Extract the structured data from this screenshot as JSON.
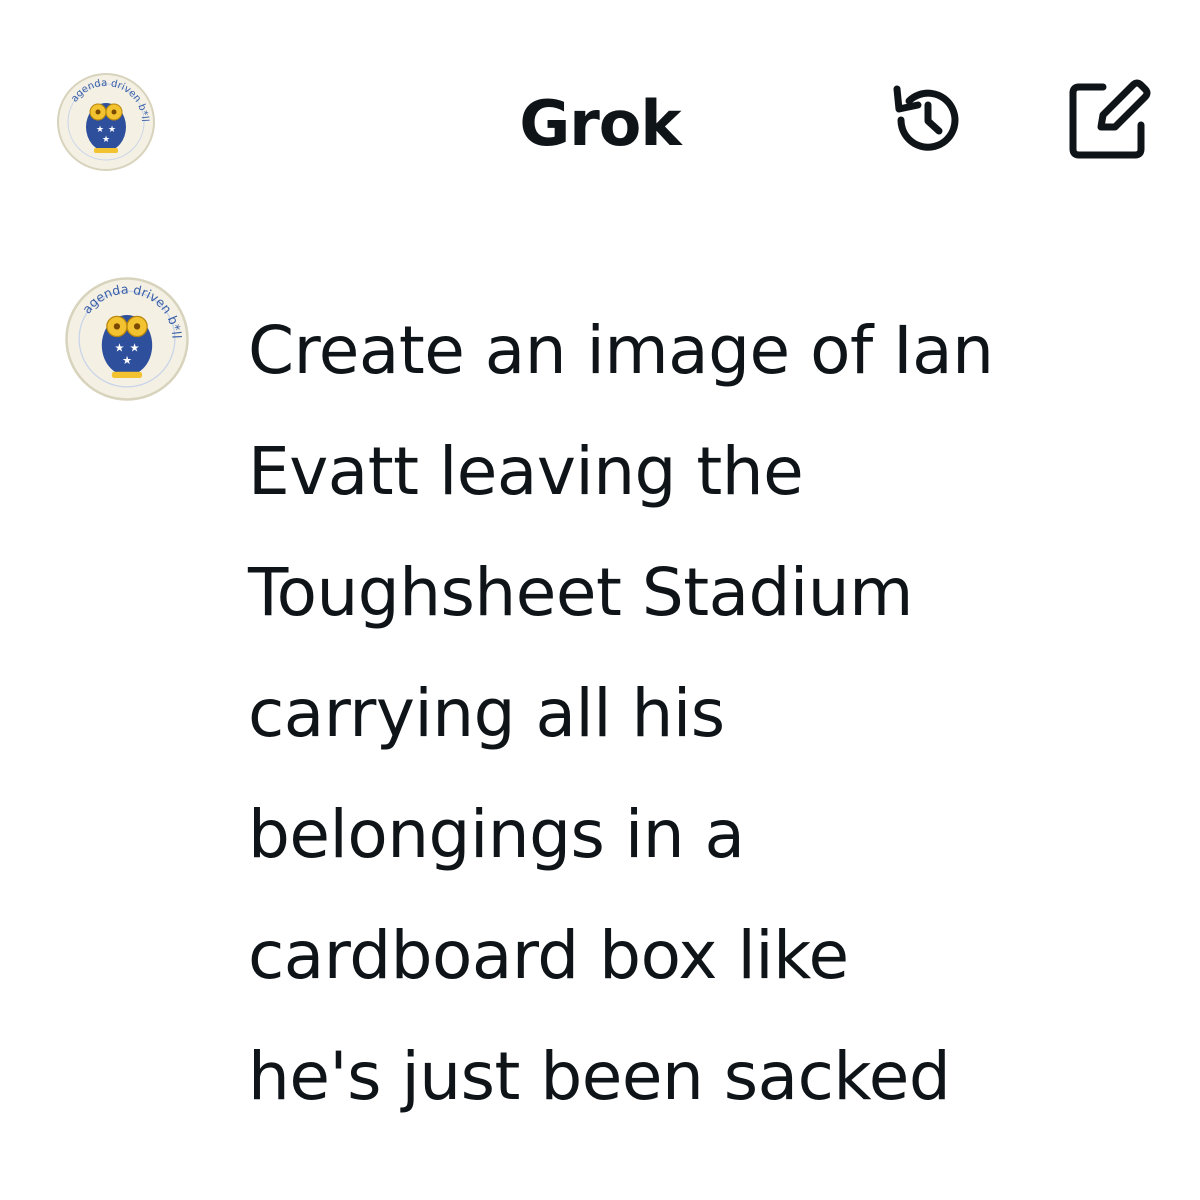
{
  "header": {
    "title": "Grok",
    "avatar_icon": "owl-logo-icon",
    "history_icon": "history-icon",
    "compose_icon": "compose-icon"
  },
  "message": {
    "avatar_icon": "owl-logo-icon",
    "avatar_ring_text": "agenda driven b*llocks",
    "text": "Create an image of Ian\nEvatt leaving the\nToughsheet Stadium\ncarrying all his\nbelongings in a\ncardboard box like\nhe's just been sacked"
  },
  "colors": {
    "text": "#0f1419",
    "background": "#ffffff",
    "logo_blue": "#2e4f9c",
    "logo_yellow": "#f2c230"
  }
}
